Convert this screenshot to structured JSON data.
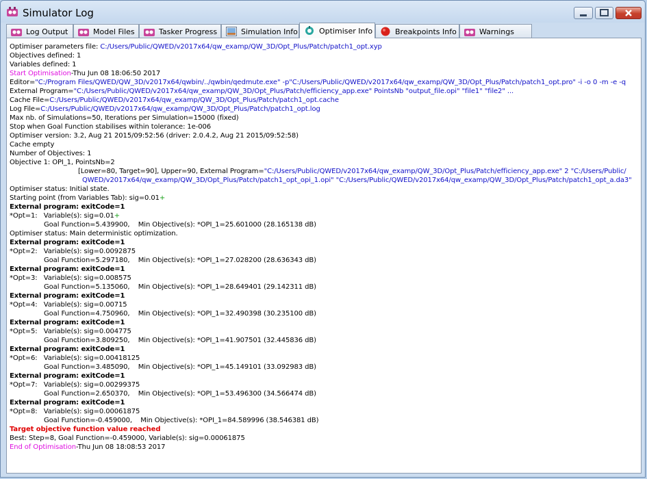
{
  "window": {
    "title": "Simulator Log",
    "controls": [
      "minimize",
      "maximize",
      "close"
    ]
  },
  "tabs": [
    {
      "label": "Log Output",
      "icon": "qw-logo-icon",
      "active": false
    },
    {
      "label": "Model Files",
      "icon": "qw-logo-icon",
      "active": false
    },
    {
      "label": "Tasker Progress",
      "icon": "qw-logo-icon",
      "active": false
    },
    {
      "label": "Simulation Info",
      "icon": "simulation-image-icon",
      "active": false
    },
    {
      "label": "Optimiser Info",
      "icon": "optimiser-icon",
      "active": true
    },
    {
      "label": "Breakpoints Info",
      "icon": "breakpoint-icon",
      "active": false
    },
    {
      "label": "Warnings",
      "icon": "qw-logo-icon",
      "active": false
    }
  ],
  "colors": {
    "link": "#1010c8",
    "marker": "#e010e0",
    "plus": "#16a016",
    "alert": "#e00000"
  },
  "log": {
    "params_label": "Optimiser parameters file: ",
    "params_path": "C:/Users/Public/QWED/v2017x64/qw_examp/QW_3D/Opt_Plus/Patch/patch1_opt.xyp",
    "objectives_defined": "Objectives defined: 1",
    "variables_defined": "Variables defined: 1",
    "start_label": "Start Optimisation",
    "start_time": "-Thu Jun 08 18:06:50 2017",
    "editor_label": "Editor=",
    "editor_value": "\"C:/Program Files/QWED/QW_3D/v2017x64/qwbin/../qwbin/qedmute.exe\" -p\"C:/Users/Public/QWED/v2017x64/qw_examp/QW_3D/Opt_Plus/Patch/patch1_opt.pro\" -i -o 0 -m -e -q",
    "ext_label": "External Program=",
    "ext_value": "\"C:/Users/Public/QWED/v2017x64/qw_examp/QW_3D/Opt_Plus/Patch/efficiency_app.exe\" PointsNb \"output_file.opi\" \"file1\" \"file2\" ...",
    "cache_label": "Cache File=",
    "cache_value": "C:/Users/Public/QWED/v2017x64/qw_examp/QW_3D/Opt_Plus/Patch/patch1_opt.cache",
    "logfile_label": "Log File=",
    "logfile_value": "C:/Users/Public/QWED/v2017x64/qw_examp/QW_3D/Opt_Plus/Patch/patch1_opt.log",
    "max_sims": "Max nb. of Simulations=50, Iterations per Simulation=15000 (fixed)",
    "stop_when": "Stop when Goal Function stabilises within tolerance: 1e-006",
    "version": "Optimiser version: 3.2, Aug 21 2015/09:52:56 (driver: 2.0.4.2, Aug 21 2015/09:52:58)",
    "cache_empty": "Cache empty",
    "num_objectives": "Number of Objectives: 1",
    "objective1": "Objective 1: OPI_1, PointsNb=2",
    "objective1_detail": "[Lower=80, Target=90], Upper=90, External Program=",
    "objective1_prog": "\"C:/Users/Public/QWED/v2017x64/qw_examp/QW_3D/Opt_Plus/Patch/efficiency_app.exe\" 2 \"C:/Users/Public/",
    "objective1_prog2": "QWED/v2017x64/qw_examp/QW_3D/Opt_Plus/Patch/patch1_opt_opi_1.opi\" \"C:/Users/Public/QWED/v2017x64/qw_examp/QW_3D/Opt_Plus/Patch/patch1_opt_a.da3\"",
    "status_initial": "Optimiser status: Initial state.",
    "starting_point": "Starting point (from Variables Tab): sig=0.01",
    "plus": "+",
    "exit_code": "External program: exitCode=1",
    "status_main": "Optimiser status: Main deterministic optimization.",
    "steps": [
      {
        "opt": "*Opt=1:   Variable(s): sig=0.01",
        "plus": true,
        "goal": "Goal Function=5.439900,    Min Objective(s): *OPI_1=25.601000 (28.165138 dB)"
      },
      {
        "opt": "*Opt=2:   Variable(s): sig=0.0092875",
        "plus": false,
        "goal": "Goal Function=5.297180,    Min Objective(s): *OPI_1=27.028200 (28.636343 dB)"
      },
      {
        "opt": "*Opt=3:   Variable(s): sig=0.008575",
        "plus": false,
        "goal": "Goal Function=5.135060,    Min Objective(s): *OPI_1=28.649401 (29.142311 dB)"
      },
      {
        "opt": "*Opt=4:   Variable(s): sig=0.00715",
        "plus": false,
        "goal": "Goal Function=4.750960,    Min Objective(s): *OPI_1=32.490398 (30.235100 dB)"
      },
      {
        "opt": "*Opt=5:   Variable(s): sig=0.004775",
        "plus": false,
        "goal": "Goal Function=3.809250,    Min Objective(s): *OPI_1=41.907501 (32.445836 dB)"
      },
      {
        "opt": "*Opt=6:   Variable(s): sig=0.00418125",
        "plus": false,
        "goal": "Goal Function=3.485090,    Min Objective(s): *OPI_1=45.149101 (33.092983 dB)"
      },
      {
        "opt": "*Opt=7:   Variable(s): sig=0.00299375",
        "plus": false,
        "goal": "Goal Function=2.650370,    Min Objective(s): *OPI_1=53.496300 (34.566474 dB)"
      },
      {
        "opt": "*Opt=8:   Variable(s): sig=0.00061875",
        "plus": false,
        "goal": "Goal Function=-0.459000,    Min Objective(s): *OPI_1=84.589996 (38.546381 dB)"
      }
    ],
    "target_reached": "Target objective function value reached",
    "best": "Best: Step=8, Goal Function=-0.459000, Variable(s): sig=0.00061875",
    "end_label": "End of Optimisation",
    "end_time": "-Thu Jun 08 18:08:53 2017"
  }
}
